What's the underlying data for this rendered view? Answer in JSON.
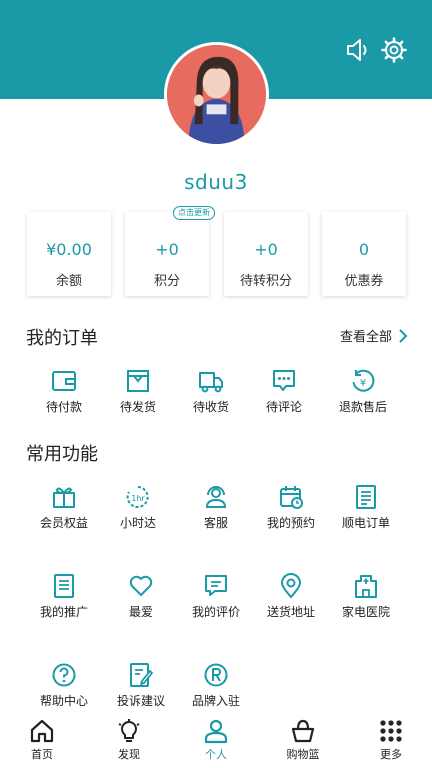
{
  "header": {
    "username": "sduu3"
  },
  "stats": [
    {
      "value": "¥0.00",
      "label": "余额"
    },
    {
      "value": "+0",
      "label": "积分",
      "badge": "点击更新"
    },
    {
      "value": "+0",
      "label": "待转积分"
    },
    {
      "value": "0",
      "label": "优惠券"
    }
  ],
  "orders": {
    "title": "我的订单",
    "view_all": "查看全部",
    "items": [
      {
        "label": "待付款",
        "icon": "wallet-icon"
      },
      {
        "label": "待发货",
        "icon": "package-icon"
      },
      {
        "label": "待收货",
        "icon": "truck-icon"
      },
      {
        "label": "待评论",
        "icon": "comment-icon"
      },
      {
        "label": "退款售后",
        "icon": "refund-icon"
      }
    ]
  },
  "functions": {
    "title": "常用功能",
    "items": [
      {
        "label": "会员权益",
        "icon": "gift-icon"
      },
      {
        "label": "小时达",
        "icon": "hour-icon"
      },
      {
        "label": "客服",
        "icon": "headset-icon"
      },
      {
        "label": "我的预约",
        "icon": "calendar-icon"
      },
      {
        "label": "顺电订单",
        "icon": "list-icon"
      },
      {
        "label": "我的推广",
        "icon": "document-icon"
      },
      {
        "label": "最爱",
        "icon": "heart-icon"
      },
      {
        "label": "我的评价",
        "icon": "review-icon"
      },
      {
        "label": "送货地址",
        "icon": "location-icon"
      },
      {
        "label": "家电医院",
        "icon": "hospital-icon"
      },
      {
        "label": "帮助中心",
        "icon": "help-icon"
      },
      {
        "label": "投诉建议",
        "icon": "feedback-icon"
      },
      {
        "label": "品牌入驻",
        "icon": "registered-icon"
      }
    ]
  },
  "tabs": [
    {
      "label": "首页",
      "icon": "home-icon"
    },
    {
      "label": "发现",
      "icon": "bulb-icon"
    },
    {
      "label": "个人",
      "icon": "person-icon",
      "active": true
    },
    {
      "label": "购物篮",
      "icon": "basket-icon"
    },
    {
      "label": "更多",
      "icon": "grid-icon"
    }
  ],
  "colors": {
    "accent": "#1a9aa6",
    "text": "#222222"
  }
}
